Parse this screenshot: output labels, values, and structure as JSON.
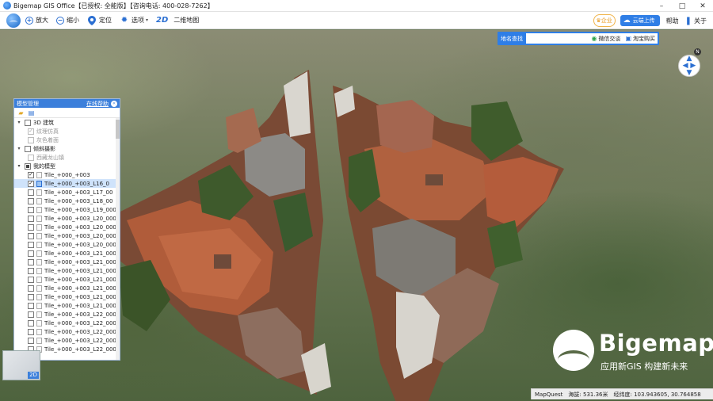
{
  "window": {
    "title": "Bigemap GIS Office【已授权: 全能版】【咨询电话: 400-028-7262】",
    "controls": {
      "minimize": "–",
      "maximize": "□",
      "close": "✕"
    }
  },
  "toolbar": {
    "zoom_in": "放大",
    "zoom_out": "缩小",
    "locate": "定位",
    "options": "选项",
    "mode_badge": "2D",
    "mode_label": "二维地图",
    "enterprise": "企业",
    "cloud_upload": "云端上传",
    "help": "帮助",
    "about": "关于"
  },
  "search": {
    "label": "地名查找",
    "value": "",
    "wechat": "微信交谈",
    "taobao": "淘宝购买"
  },
  "compass": {
    "north_label": "N"
  },
  "panel": {
    "title": "模型管理",
    "online_help": "在线帮助",
    "tree": [
      {
        "label": "3D 建筑",
        "level": 0,
        "expand": "▾",
        "check": "empty",
        "dim": false
      },
      {
        "label": "纹理仿真",
        "level": 1,
        "check": "checked-dis",
        "dim": true
      },
      {
        "label": "灰色着面",
        "level": 1,
        "check": "dis",
        "dim": true
      },
      {
        "label": "倾斜摄影",
        "level": 0,
        "expand": "▾",
        "check": "empty",
        "dim": false
      },
      {
        "label": "西藏龙山镇",
        "level": 1,
        "check": "dis",
        "dim": true
      },
      {
        "label": "我的模型",
        "level": 0,
        "expand": "▾",
        "check": "partial",
        "dim": false
      },
      {
        "label": "Tile_+000_+003",
        "level": 1,
        "check": "checked",
        "dim": false
      },
      {
        "label": "Tile_+000_+003_L16_0",
        "level": 1,
        "check": "checked",
        "dim": false,
        "selected": true
      },
      {
        "label": "Tile_+000_+003_L17_00",
        "level": 1,
        "check": "empty",
        "dim": false
      },
      {
        "label": "Tile_+000_+003_L18_00",
        "level": 1,
        "check": "empty",
        "dim": false
      },
      {
        "label": "Tile_+000_+003_L19_000",
        "level": 1,
        "check": "empty",
        "dim": false
      },
      {
        "label": "Tile_+000_+003_L20_000",
        "level": 1,
        "check": "empty",
        "dim": false
      },
      {
        "label": "Tile_+000_+003_L20_000",
        "level": 1,
        "check": "empty",
        "dim": false
      },
      {
        "label": "Tile_+000_+003_L20_000",
        "level": 1,
        "check": "empty",
        "dim": false
      },
      {
        "label": "Tile_+000_+003_L20_000",
        "level": 1,
        "check": "empty",
        "dim": false
      },
      {
        "label": "Tile_+000_+003_L21_000",
        "level": 1,
        "check": "empty",
        "dim": false
      },
      {
        "label": "Tile_+000_+003_L21_000",
        "level": 1,
        "check": "empty",
        "dim": false
      },
      {
        "label": "Tile_+000_+003_L21_000",
        "level": 1,
        "check": "empty",
        "dim": false
      },
      {
        "label": "Tile_+000_+003_L21_000",
        "level": 1,
        "check": "empty",
        "dim": false
      },
      {
        "label": "Tile_+000_+003_L21_000",
        "level": 1,
        "check": "empty",
        "dim": false
      },
      {
        "label": "Tile_+000_+003_L21_000",
        "level": 1,
        "check": "empty",
        "dim": false
      },
      {
        "label": "Tile_+000_+003_L21_000",
        "level": 1,
        "check": "empty",
        "dim": false
      },
      {
        "label": "Tile_+000_+003_L22_000",
        "level": 1,
        "check": "empty",
        "dim": false
      },
      {
        "label": "Tile_+000_+003_L22_000",
        "level": 1,
        "check": "empty",
        "dim": false
      },
      {
        "label": "Tile_+000_+003_L22_000",
        "level": 1,
        "check": "empty",
        "dim": false
      },
      {
        "label": "Tile_+000_+003_L22_000",
        "level": 1,
        "check": "empty",
        "dim": false
      },
      {
        "label": "Tile_+000_+003_L22_000",
        "level": 1,
        "check": "empty",
        "dim": false
      }
    ]
  },
  "minimap": {
    "mode": "2D"
  },
  "watermark": {
    "brand": "Bigemap",
    "slogan": "应用新GIS  构建新未来"
  },
  "status": {
    "provider": "MapQuest",
    "altitude": "海拔: 531.36米",
    "coords": "经纬度: 103.943605, 30.764858"
  },
  "colors": {
    "accent": "#2f7ee6",
    "panel_header": "#3b7fdb",
    "roof": "#a8593a",
    "terrain": "#5e7046"
  }
}
